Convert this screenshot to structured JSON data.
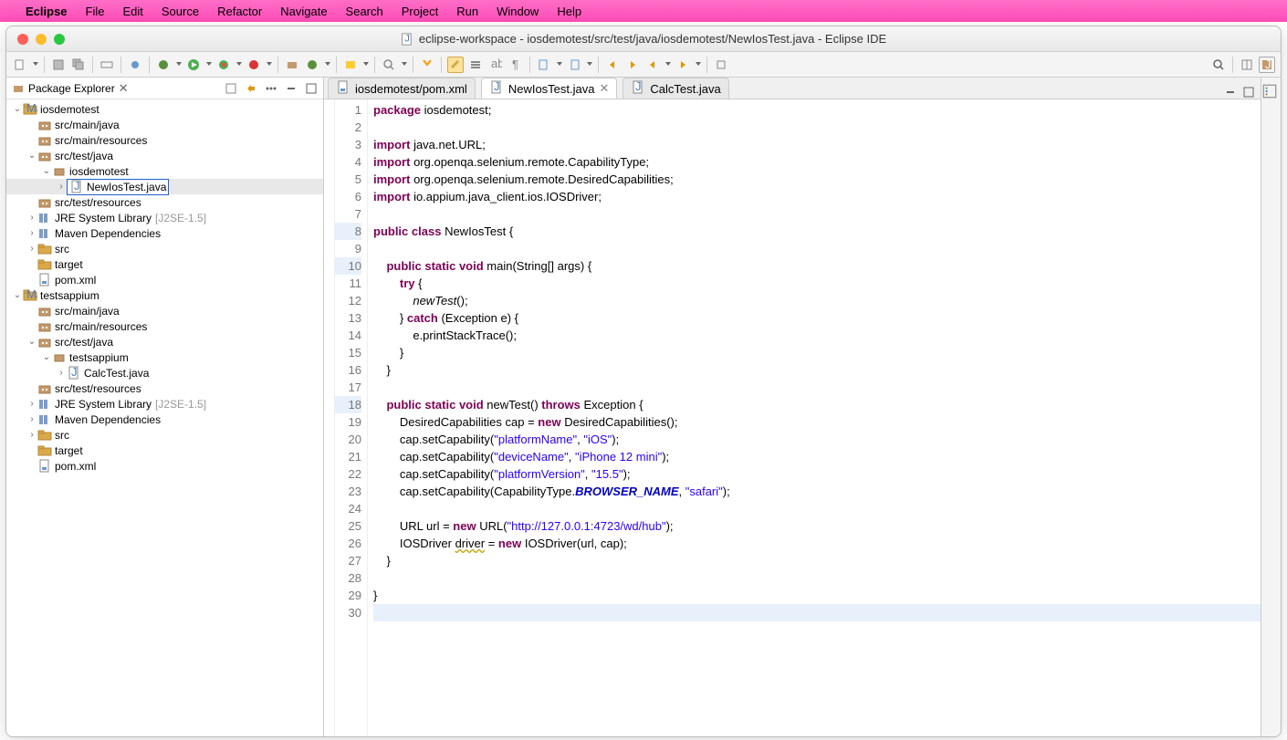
{
  "menubar": {
    "app": "Eclipse",
    "items": [
      "File",
      "Edit",
      "Source",
      "Refactor",
      "Navigate",
      "Search",
      "Project",
      "Run",
      "Window",
      "Help"
    ]
  },
  "window": {
    "title": "eclipse-workspace - iosdemotest/src/test/java/iosdemotest/NewIosTest.java - Eclipse IDE"
  },
  "packageExplorer": {
    "title": "Package Explorer",
    "tree": [
      {
        "d": 0,
        "a": "open",
        "i": "proj",
        "t": "iosdemotest"
      },
      {
        "d": 1,
        "a": "none",
        "i": "pkg",
        "t": "src/main/java"
      },
      {
        "d": 1,
        "a": "none",
        "i": "pkg",
        "t": "src/main/resources"
      },
      {
        "d": 1,
        "a": "open",
        "i": "pkg",
        "t": "src/test/java"
      },
      {
        "d": 2,
        "a": "open",
        "i": "pkgleaf",
        "t": "iosdemotest"
      },
      {
        "d": 3,
        "a": "closed",
        "i": "java",
        "t": "NewIosTest.java",
        "sel": true
      },
      {
        "d": 1,
        "a": "none",
        "i": "pkg",
        "t": "src/test/resources"
      },
      {
        "d": 1,
        "a": "closed",
        "i": "lib",
        "t": "JRE System Library",
        "s": "[J2SE-1.5]"
      },
      {
        "d": 1,
        "a": "closed",
        "i": "lib",
        "t": "Maven Dependencies"
      },
      {
        "d": 1,
        "a": "closed",
        "i": "folder",
        "t": "src"
      },
      {
        "d": 1,
        "a": "none",
        "i": "folder",
        "t": "target"
      },
      {
        "d": 1,
        "a": "none",
        "i": "file",
        "t": "pom.xml"
      },
      {
        "d": 0,
        "a": "open",
        "i": "proj",
        "t": "testsappium"
      },
      {
        "d": 1,
        "a": "none",
        "i": "pkg",
        "t": "src/main/java"
      },
      {
        "d": 1,
        "a": "none",
        "i": "pkg",
        "t": "src/main/resources"
      },
      {
        "d": 1,
        "a": "open",
        "i": "pkg",
        "t": "src/test/java"
      },
      {
        "d": 2,
        "a": "open",
        "i": "pkgleaf",
        "t": "testsappium"
      },
      {
        "d": 3,
        "a": "closed",
        "i": "java",
        "t": "CalcTest.java"
      },
      {
        "d": 1,
        "a": "none",
        "i": "pkg",
        "t": "src/test/resources"
      },
      {
        "d": 1,
        "a": "closed",
        "i": "lib",
        "t": "JRE System Library",
        "s": "[J2SE-1.5]"
      },
      {
        "d": 1,
        "a": "closed",
        "i": "lib",
        "t": "Maven Dependencies"
      },
      {
        "d": 1,
        "a": "closed",
        "i": "folder",
        "t": "src"
      },
      {
        "d": 1,
        "a": "none",
        "i": "folder",
        "t": "target"
      },
      {
        "d": 1,
        "a": "none",
        "i": "file",
        "t": "pom.xml"
      }
    ]
  },
  "editorTabs": [
    {
      "label": "iosdemotest/pom.xml",
      "icon": "file",
      "active": false,
      "close": false
    },
    {
      "label": "NewIosTest.java",
      "icon": "java",
      "active": true,
      "close": true
    },
    {
      "label": "CalcTest.java",
      "icon": "java",
      "active": false,
      "close": false
    }
  ],
  "editor": {
    "lineCount": 30,
    "highlightedLines": [
      8,
      10,
      18
    ],
    "cursorLine": 30,
    "code": [
      [
        [
          "kw",
          "package"
        ],
        [
          "",
          " iosdemotest;"
        ]
      ],
      [],
      [
        [
          "kw",
          "import"
        ],
        [
          "",
          " java.net.URL;"
        ]
      ],
      [
        [
          "kw",
          "import"
        ],
        [
          "",
          " org.openqa.selenium.remote.CapabilityType;"
        ]
      ],
      [
        [
          "kw",
          "import"
        ],
        [
          "",
          " org.openqa.selenium.remote.DesiredCapabilities;"
        ]
      ],
      [
        [
          "kw",
          "import"
        ],
        [
          "",
          " io.appium.java_client.ios.IOSDriver;"
        ]
      ],
      [],
      [
        [
          "kw",
          "public"
        ],
        [
          "",
          " "
        ],
        [
          "kw",
          "class"
        ],
        [
          "",
          " NewIosTest {"
        ]
      ],
      [],
      [
        [
          "",
          "    "
        ],
        [
          "kw",
          "public"
        ],
        [
          "",
          " "
        ],
        [
          "kw",
          "static"
        ],
        [
          "",
          " "
        ],
        [
          "kw",
          "void"
        ],
        [
          "",
          " main(String[] args) {"
        ]
      ],
      [
        [
          "",
          "        "
        ],
        [
          "kw",
          "try"
        ],
        [
          "",
          " {"
        ]
      ],
      [
        [
          "",
          "            "
        ],
        [
          "mth",
          "newTest"
        ],
        [
          "",
          "();"
        ]
      ],
      [
        [
          "",
          "        } "
        ],
        [
          "kw",
          "catch"
        ],
        [
          "",
          " (Exception e) {"
        ]
      ],
      [
        [
          "",
          "            e.printStackTrace();"
        ]
      ],
      [
        [
          "",
          "        }"
        ]
      ],
      [
        [
          "",
          "    }"
        ]
      ],
      [],
      [
        [
          "",
          "    "
        ],
        [
          "kw",
          "public"
        ],
        [
          "",
          " "
        ],
        [
          "kw",
          "static"
        ],
        [
          "",
          " "
        ],
        [
          "kw",
          "void"
        ],
        [
          "",
          " newTest() "
        ],
        [
          "kw",
          "throws"
        ],
        [
          "",
          " Exception {"
        ]
      ],
      [
        [
          "",
          "        DesiredCapabilities cap = "
        ],
        [
          "kw",
          "new"
        ],
        [
          "",
          " DesiredCapabilities();"
        ]
      ],
      [
        [
          "",
          "        cap.setCapability("
        ],
        [
          "str",
          "\"platformName\""
        ],
        [
          "",
          ", "
        ],
        [
          "str",
          "\"iOS\""
        ],
        [
          "",
          ");"
        ]
      ],
      [
        [
          "",
          "        cap.setCapability("
        ],
        [
          "str",
          "\"deviceName\""
        ],
        [
          "",
          ", "
        ],
        [
          "str",
          "\"iPhone 12 mini\""
        ],
        [
          "",
          ");"
        ]
      ],
      [
        [
          "",
          "        cap.setCapability("
        ],
        [
          "str",
          "\"platformVersion\""
        ],
        [
          "",
          ", "
        ],
        [
          "str",
          "\"15.5\""
        ],
        [
          "",
          ");"
        ]
      ],
      [
        [
          "",
          "        cap.setCapability(CapabilityType."
        ],
        [
          "fld",
          "BROWSER_NAME"
        ],
        [
          "",
          ", "
        ],
        [
          "str",
          "\"safari\""
        ],
        [
          "",
          ");"
        ]
      ],
      [],
      [
        [
          "",
          "        URL url = "
        ],
        [
          "kw",
          "new"
        ],
        [
          "",
          " URL("
        ],
        [
          "str",
          "\"http://127.0.0.1:4723/wd/hub\""
        ],
        [
          "",
          ");"
        ]
      ],
      [
        [
          "",
          "        IOSDriver "
        ],
        [
          "warn",
          "driver"
        ],
        [
          "",
          " = "
        ],
        [
          "kw",
          "new"
        ],
        [
          "",
          " IOSDriver(url, cap);"
        ]
      ],
      [
        [
          "",
          "    }"
        ]
      ],
      [],
      [
        [
          "",
          "}"
        ]
      ],
      []
    ]
  }
}
